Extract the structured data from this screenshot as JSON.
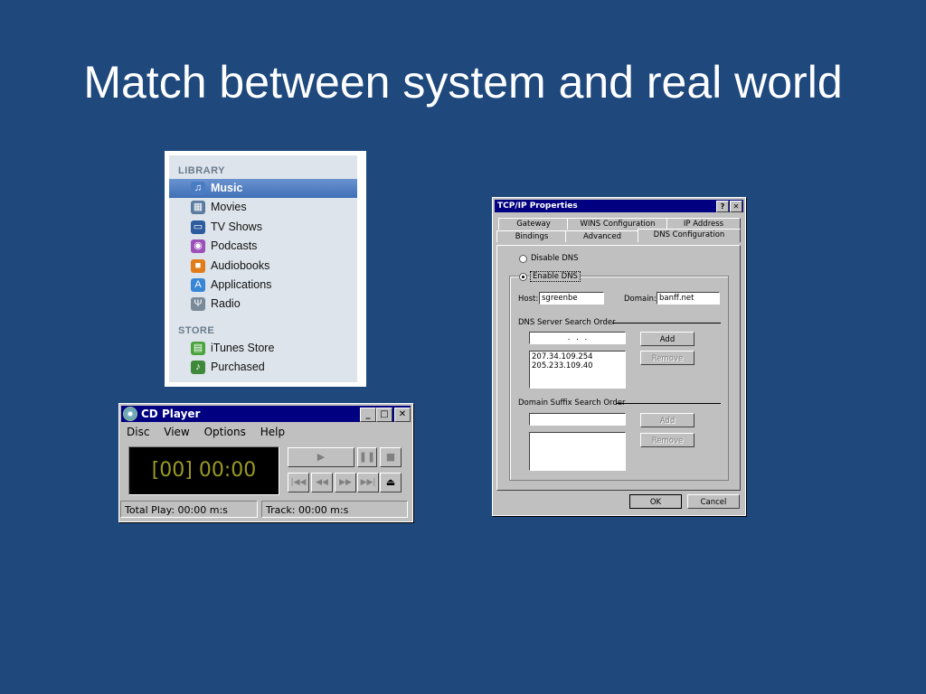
{
  "slide": {
    "title": "Match between system and real world"
  },
  "itunes": {
    "library_header": "LIBRARY",
    "store_header": "STORE",
    "library_items": [
      {
        "label": "Music",
        "icon": "music-note-icon",
        "color": "#4a7cc4",
        "glyph": "♫",
        "selected": true
      },
      {
        "label": "Movies",
        "icon": "film-icon",
        "color": "#5a7aa0",
        "glyph": "▦"
      },
      {
        "label": "TV Shows",
        "icon": "tv-icon",
        "color": "#2d5c9e",
        "glyph": "▭"
      },
      {
        "label": "Podcasts",
        "icon": "podcast-icon",
        "color": "#9b4fb8",
        "glyph": "◉"
      },
      {
        "label": "Audiobooks",
        "icon": "book-icon",
        "color": "#e07d1a",
        "glyph": "■"
      },
      {
        "label": "Applications",
        "icon": "app-store-icon",
        "color": "#3a86d6",
        "glyph": "A"
      },
      {
        "label": "Radio",
        "icon": "antenna-icon",
        "color": "#7a8a99",
        "glyph": "Ψ"
      }
    ],
    "store_items": [
      {
        "label": "iTunes Store",
        "icon": "store-icon",
        "color": "#4aa33d",
        "glyph": "▤"
      },
      {
        "label": "Purchased",
        "icon": "purchased-icon",
        "color": "#3f8a3a",
        "glyph": "♪"
      }
    ]
  },
  "cdplayer": {
    "title": "CD Player",
    "menu": [
      "Disc",
      "View",
      "Options",
      "Help"
    ],
    "display": "[00] 00:00",
    "total_play": "Total Play: 00:00 m:s",
    "track": "Track: 00:00 m:s",
    "win_buttons": {
      "minimize": "_",
      "maximize": "□",
      "close": "✕"
    },
    "controls": {
      "play": "▶",
      "pause": "❚❚",
      "stop": "■",
      "prev_track": "|◀◀",
      "rewind": "◀◀",
      "forward": "▶▶",
      "next_track": "▶▶|",
      "eject": "⏏"
    }
  },
  "tcpip": {
    "title": "TCP/IP Properties",
    "help_btn": "?",
    "close_btn": "✕",
    "tabs_back": [
      "Gateway",
      "WINS Configuration",
      "IP Address"
    ],
    "tabs_front": [
      "Bindings",
      "Advanced",
      "DNS Configuration"
    ],
    "disable_dns": "Disable DNS",
    "enable_dns": "Enable DNS",
    "host_label": "Host:",
    "host_value": "sgreenbe",
    "domain_label": "Domain:",
    "domain_value": "banff.net",
    "dns_group": "DNS Server Search Order",
    "dns_ip_placeholder": ".     .     .",
    "dns_servers": [
      "207.34.109.254",
      "205.233.109.40"
    ],
    "add": "Add",
    "remove": "Remove",
    "suffix_group": "Domain Suffix Search Order",
    "ok": "OK",
    "cancel": "Cancel"
  }
}
